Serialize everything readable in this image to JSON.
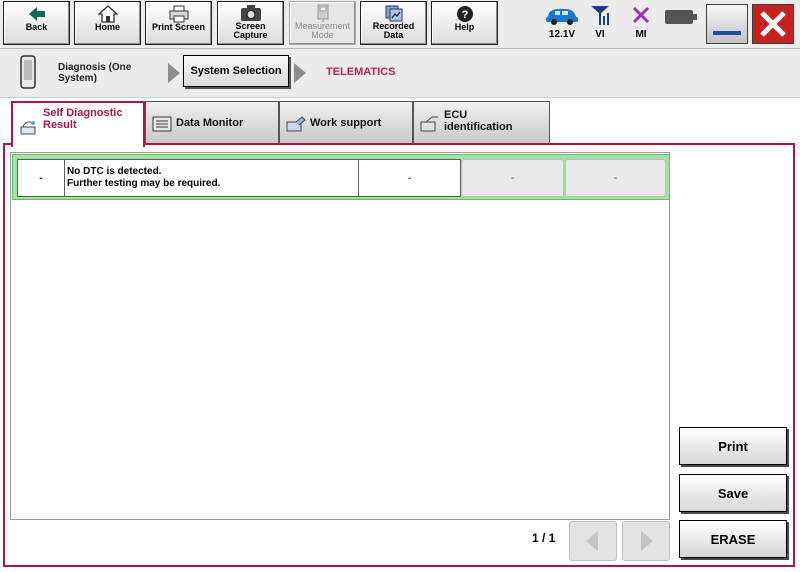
{
  "toolbar": {
    "back": {
      "label": "Back",
      "icon": "back-arrow-icon"
    },
    "home": {
      "label": "Home",
      "icon": "home-icon"
    },
    "print_screen": {
      "label": "Print Screen",
      "icon": "printer-icon"
    },
    "screen_capture": {
      "label1": "Screen",
      "label2": "Capture",
      "icon": "camera-icon"
    },
    "measurement_mode": {
      "label1": "Measurement",
      "label2": "Mode",
      "icon": "meter-icon",
      "enabled": false
    },
    "recorded_data": {
      "label1": "Recorded",
      "label2": "Data",
      "icon": "recorded-data-icon"
    },
    "help": {
      "label": "Help",
      "icon": "help-icon"
    }
  },
  "status": {
    "voltage": {
      "label": "12.1V",
      "icon": "car-icon"
    },
    "vi": {
      "label": "VI",
      "icon": "antenna-icon"
    },
    "mi": {
      "label": "MI",
      "icon": "x-mark-icon"
    },
    "battery": {
      "icon": "battery-icon"
    }
  },
  "breadcrumb": {
    "step1": "Diagnosis (One System)",
    "step1_line1": "Diagnosis (One",
    "step1_line2": "System)",
    "step2": "System Selection",
    "current": "TELEMATICS"
  },
  "tabs": [
    {
      "label1": "Self Diagnostic",
      "label2": "Result",
      "active": true
    },
    {
      "label1": "Data Monitor",
      "label2": ""
    },
    {
      "label1": "Work support",
      "label2": ""
    },
    {
      "label1": "ECU",
      "label2": "identification"
    }
  ],
  "dtc_row": {
    "code": "-",
    "message_line1": "No DTC is detected.",
    "message_line2": "Further testing may be required.",
    "col3": "-",
    "col4": "-",
    "col5": "-"
  },
  "actions": {
    "print": "Print",
    "save": "Save",
    "erase": "ERASE"
  },
  "pager": {
    "text": "1 / 1"
  },
  "colors": {
    "accent": "#b0154a",
    "row_highlight": "#9fe49f",
    "crumb_red": "#c0234b"
  }
}
